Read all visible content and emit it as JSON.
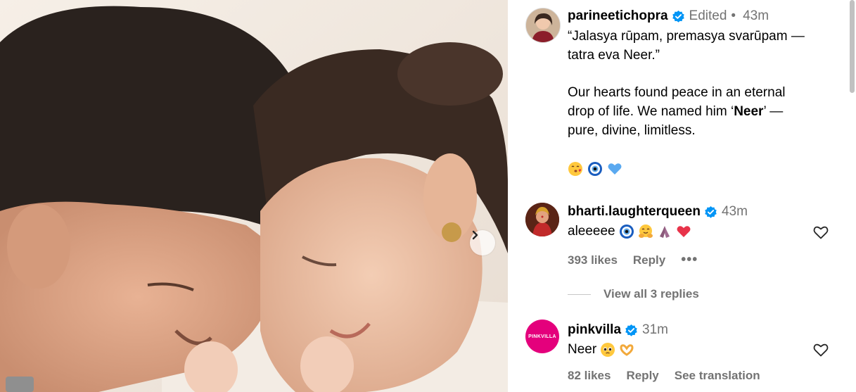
{
  "photo": {
    "next_label": "Next"
  },
  "post": {
    "username": "parineetichopra",
    "edited": "Edited",
    "separator": "•",
    "time": "43m",
    "caption_quote_line1": "“Jalasya rūpam, premasya svarūpam —",
    "caption_quote_line2": "tatra eva Neer.”",
    "caption_p2_line1": "Our hearts found peace in an eternal",
    "caption_p2_line2_a": "drop of life. We named him ‘",
    "caption_p2_name": "Neer",
    "caption_p2_line2_b": "’ —",
    "caption_p2_line3": "pure, divine, limitless.",
    "emojis": [
      "kissing-face",
      "nazar-amulet",
      "blue-heart"
    ]
  },
  "comments": [
    {
      "username": "bharti.laughterqueen",
      "time": "43m",
      "text": "aleeeee",
      "emojis": [
        "nazar-amulet",
        "hugging-face",
        "folded-hands",
        "red-heart"
      ],
      "likes": "393 likes",
      "reply": "Reply",
      "more": "•••",
      "view_replies": "View all 3 replies"
    },
    {
      "username": "pinkvilla",
      "avatar_text": "PINKVILLA",
      "time": "31m",
      "text": "Neer",
      "emojis": [
        "pleading-face",
        "heart-hands"
      ],
      "likes": "82 likes",
      "reply": "Reply",
      "translation": "See translation"
    }
  ],
  "colors": {
    "verified": "#0095f6",
    "secondary": "#737373",
    "pinkvilla": "#e4007c",
    "nazar": "#1a5dbf",
    "blue_heart": "#5aa9f0",
    "red_heart": "#e8334a"
  }
}
